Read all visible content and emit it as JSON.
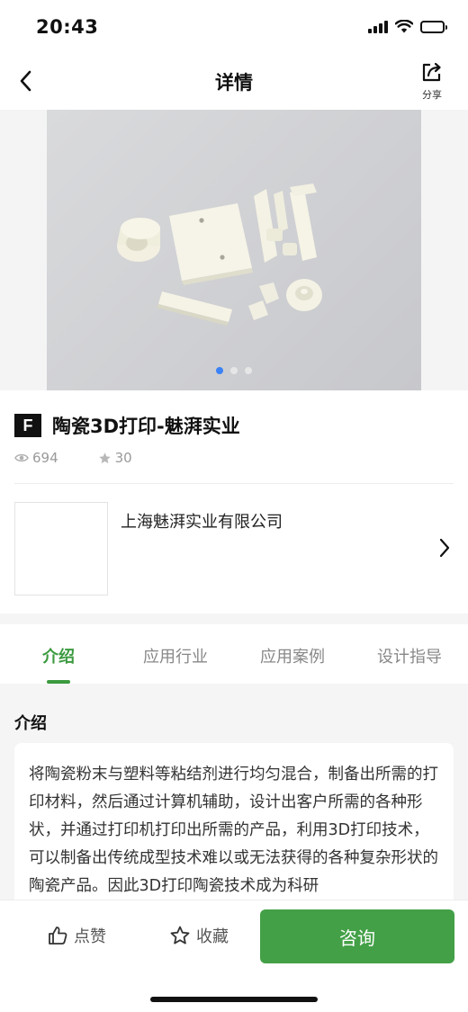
{
  "status_bar": {
    "time": "20:43"
  },
  "nav": {
    "title": "详情",
    "share_label": "分享"
  },
  "gallery": {
    "page_count": 3,
    "active_index": 0
  },
  "product": {
    "badge": "F",
    "title": "陶瓷3D打印-魅湃实业",
    "views": "694",
    "favorites": "30"
  },
  "company": {
    "name": "上海魅湃实业有限公司"
  },
  "tabs": [
    {
      "label": "介绍",
      "active": true
    },
    {
      "label": "应用行业",
      "active": false
    },
    {
      "label": "应用案例",
      "active": false
    },
    {
      "label": "设计指导",
      "active": false
    }
  ],
  "intro": {
    "heading": "介绍",
    "text": "将陶瓷粉末与塑料等粘结剂进行均匀混合，制备出所需的打印材料，然后通过计算机辅助，设计出客户所需的各种形状，并通过打印机打印出所需的产品，利用3D打印技术，可以制备出传统成型技术难以或无法获得的各种复杂形状的陶瓷产品。因此3D打印陶瓷技术成为科研"
  },
  "bottom_bar": {
    "like_label": "点赞",
    "favorite_label": "收藏",
    "consult_label": "咨询"
  },
  "colors": {
    "accent_green": "#43a047",
    "tab_active": "#3c9a3f",
    "dot_active": "#3b82f6"
  },
  "icons": {
    "back": "chevron-left-icon",
    "share": "share-icon",
    "views": "eye-icon",
    "favorites": "star-icon",
    "company_arrow": "chevron-right-icon",
    "like": "thumbs-up-icon",
    "favorite": "star-outline-icon"
  }
}
